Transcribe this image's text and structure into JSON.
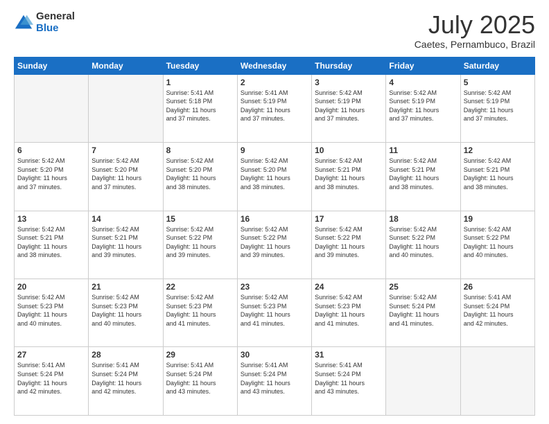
{
  "logo": {
    "general": "General",
    "blue": "Blue"
  },
  "title": {
    "month_year": "July 2025",
    "location": "Caetes, Pernambuco, Brazil"
  },
  "headers": [
    "Sunday",
    "Monday",
    "Tuesday",
    "Wednesday",
    "Thursday",
    "Friday",
    "Saturday"
  ],
  "weeks": [
    [
      {
        "day": "",
        "text": ""
      },
      {
        "day": "",
        "text": ""
      },
      {
        "day": "1",
        "text": "Sunrise: 5:41 AM\nSunset: 5:18 PM\nDaylight: 11 hours\nand 37 minutes."
      },
      {
        "day": "2",
        "text": "Sunrise: 5:41 AM\nSunset: 5:19 PM\nDaylight: 11 hours\nand 37 minutes."
      },
      {
        "day": "3",
        "text": "Sunrise: 5:42 AM\nSunset: 5:19 PM\nDaylight: 11 hours\nand 37 minutes."
      },
      {
        "day": "4",
        "text": "Sunrise: 5:42 AM\nSunset: 5:19 PM\nDaylight: 11 hours\nand 37 minutes."
      },
      {
        "day": "5",
        "text": "Sunrise: 5:42 AM\nSunset: 5:19 PM\nDaylight: 11 hours\nand 37 minutes."
      }
    ],
    [
      {
        "day": "6",
        "text": "Sunrise: 5:42 AM\nSunset: 5:20 PM\nDaylight: 11 hours\nand 37 minutes."
      },
      {
        "day": "7",
        "text": "Sunrise: 5:42 AM\nSunset: 5:20 PM\nDaylight: 11 hours\nand 37 minutes."
      },
      {
        "day": "8",
        "text": "Sunrise: 5:42 AM\nSunset: 5:20 PM\nDaylight: 11 hours\nand 38 minutes."
      },
      {
        "day": "9",
        "text": "Sunrise: 5:42 AM\nSunset: 5:20 PM\nDaylight: 11 hours\nand 38 minutes."
      },
      {
        "day": "10",
        "text": "Sunrise: 5:42 AM\nSunset: 5:21 PM\nDaylight: 11 hours\nand 38 minutes."
      },
      {
        "day": "11",
        "text": "Sunrise: 5:42 AM\nSunset: 5:21 PM\nDaylight: 11 hours\nand 38 minutes."
      },
      {
        "day": "12",
        "text": "Sunrise: 5:42 AM\nSunset: 5:21 PM\nDaylight: 11 hours\nand 38 minutes."
      }
    ],
    [
      {
        "day": "13",
        "text": "Sunrise: 5:42 AM\nSunset: 5:21 PM\nDaylight: 11 hours\nand 38 minutes."
      },
      {
        "day": "14",
        "text": "Sunrise: 5:42 AM\nSunset: 5:21 PM\nDaylight: 11 hours\nand 39 minutes."
      },
      {
        "day": "15",
        "text": "Sunrise: 5:42 AM\nSunset: 5:22 PM\nDaylight: 11 hours\nand 39 minutes."
      },
      {
        "day": "16",
        "text": "Sunrise: 5:42 AM\nSunset: 5:22 PM\nDaylight: 11 hours\nand 39 minutes."
      },
      {
        "day": "17",
        "text": "Sunrise: 5:42 AM\nSunset: 5:22 PM\nDaylight: 11 hours\nand 39 minutes."
      },
      {
        "day": "18",
        "text": "Sunrise: 5:42 AM\nSunset: 5:22 PM\nDaylight: 11 hours\nand 40 minutes."
      },
      {
        "day": "19",
        "text": "Sunrise: 5:42 AM\nSunset: 5:22 PM\nDaylight: 11 hours\nand 40 minutes."
      }
    ],
    [
      {
        "day": "20",
        "text": "Sunrise: 5:42 AM\nSunset: 5:23 PM\nDaylight: 11 hours\nand 40 minutes."
      },
      {
        "day": "21",
        "text": "Sunrise: 5:42 AM\nSunset: 5:23 PM\nDaylight: 11 hours\nand 40 minutes."
      },
      {
        "day": "22",
        "text": "Sunrise: 5:42 AM\nSunset: 5:23 PM\nDaylight: 11 hours\nand 41 minutes."
      },
      {
        "day": "23",
        "text": "Sunrise: 5:42 AM\nSunset: 5:23 PM\nDaylight: 11 hours\nand 41 minutes."
      },
      {
        "day": "24",
        "text": "Sunrise: 5:42 AM\nSunset: 5:23 PM\nDaylight: 11 hours\nand 41 minutes."
      },
      {
        "day": "25",
        "text": "Sunrise: 5:42 AM\nSunset: 5:24 PM\nDaylight: 11 hours\nand 41 minutes."
      },
      {
        "day": "26",
        "text": "Sunrise: 5:41 AM\nSunset: 5:24 PM\nDaylight: 11 hours\nand 42 minutes."
      }
    ],
    [
      {
        "day": "27",
        "text": "Sunrise: 5:41 AM\nSunset: 5:24 PM\nDaylight: 11 hours\nand 42 minutes."
      },
      {
        "day": "28",
        "text": "Sunrise: 5:41 AM\nSunset: 5:24 PM\nDaylight: 11 hours\nand 42 minutes."
      },
      {
        "day": "29",
        "text": "Sunrise: 5:41 AM\nSunset: 5:24 PM\nDaylight: 11 hours\nand 43 minutes."
      },
      {
        "day": "30",
        "text": "Sunrise: 5:41 AM\nSunset: 5:24 PM\nDaylight: 11 hours\nand 43 minutes."
      },
      {
        "day": "31",
        "text": "Sunrise: 5:41 AM\nSunset: 5:24 PM\nDaylight: 11 hours\nand 43 minutes."
      },
      {
        "day": "",
        "text": ""
      },
      {
        "day": "",
        "text": ""
      }
    ]
  ]
}
